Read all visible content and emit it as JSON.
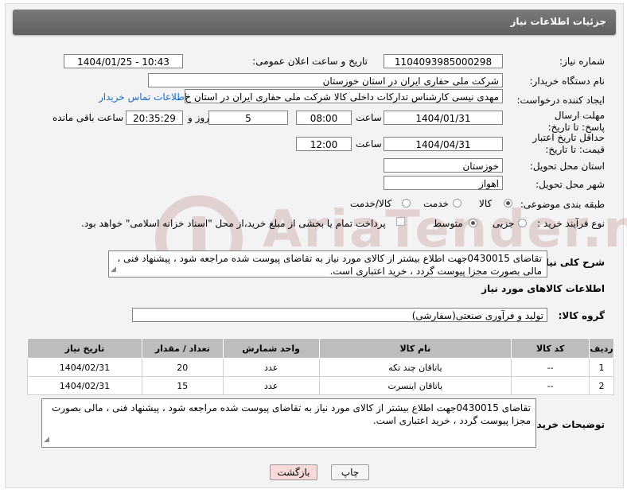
{
  "header": {
    "title": "جزئیات اطلاعات نیاز"
  },
  "fields": {
    "need_number_label": "شماره نیاز:",
    "need_number": "1104093985000298",
    "announce_label": "تاریخ و ساعت اعلان عمومی:",
    "announce_value": "1404/01/25 - 10:43",
    "buyer_label": "نام دستگاه خریدار:",
    "buyer_value": "شرکت ملی حفاری ایران در استان خوزستان",
    "creator_label": "ایجاد کننده درخواست:",
    "creator_value": "مهدی نیسی کارشناس تدارکات داخلی کالا شرکت ملی حفاری ایران در استان خ",
    "contact_link": "اطلاعات تماس خریدار",
    "deadline_label": "مهلت ارسال پاسخ: تا تاریخ:",
    "deadline_date": "1404/01/31",
    "time_word": "ساعت",
    "deadline_time": "08:00",
    "days_value": "5",
    "days_word": "روز و",
    "remaining_time": "20:35:29",
    "remaining_word": "ساعت باقی مانده",
    "validity_label": "حداقل تاریخ اعتبار قیمت: تا تاریخ:",
    "validity_date": "1404/04/31",
    "validity_time": "12:00",
    "province_label": "استان محل تحویل:",
    "province_value": "خوزستان",
    "city_label": "شهر محل تحویل:",
    "city_value": "اهواز",
    "category_label": "طبقه بندی موضوعی:",
    "category_options": [
      "کالا",
      "خدمت",
      "کالا/خدمت"
    ],
    "process_label": "نوع فرآیند خرید :",
    "process_options": [
      "جزیی",
      "متوسط"
    ],
    "payment_note": "پرداخت تمام یا بخشی از مبلغ خرید،از محل \"اسناد خزانه اسلامی\" خواهد بود."
  },
  "description": {
    "label": "شرح کلی نیاز:",
    "text": "تقاضای 0430015جهت اطلاع بیشتر از کالای مورد نیاز به تقاضای پیوست شده مراجعه شود ، پیشنهاد فنی ، مالی بصورت مجزا پیوست گردد ، خرید اعتباری است."
  },
  "goods": {
    "section_title": "اطلاعات کالاهای مورد نیاز",
    "group_label": "گروه کالا:",
    "group_value": "تولید و فرآوری صنعتی(سفارشی)",
    "columns": [
      "ردیف",
      "کد کالا",
      "نام کالا",
      "واحد شمارش",
      "تعداد / مقدار",
      "تاریخ نیاز"
    ],
    "rows": [
      [
        "1",
        "--",
        "یاتاقان چند تکه",
        "عدد",
        "20",
        "1404/02/31"
      ],
      [
        "2",
        "--",
        "یاتاقان اینسرت",
        "عدد",
        "15",
        "1404/02/31"
      ]
    ]
  },
  "buyer_notes": {
    "label": "توضیحات خریدار:",
    "text": "تقاضای 0430015جهت اطلاع بیشتر از کالای مورد نیاز به تقاضای پیوست شده مراجعه شود ، پیشنهاد فنی ، مالی بصورت مجزا پیوست گردد ، خرید اعتباری است."
  },
  "buttons": {
    "print": "چاپ",
    "back": "بازگشت"
  },
  "watermark": {
    "text": "AriaTender.neT"
  },
  "colors": {
    "header_bg": "#6b6b6b",
    "link": "#1a6cc9",
    "back_button_bg": "#f8d9d9",
    "table_header_bg": "#bdbdbd"
  }
}
